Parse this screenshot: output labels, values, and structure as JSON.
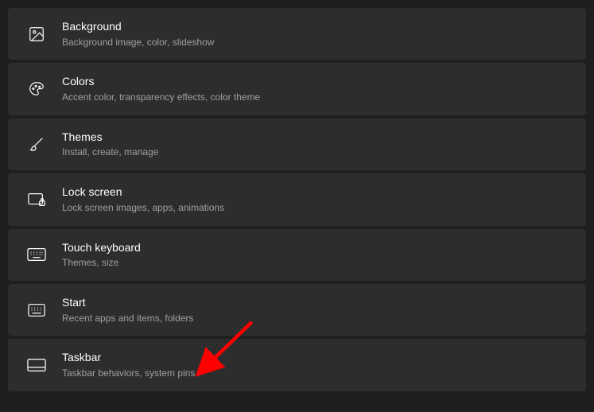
{
  "items": [
    {
      "title": "Background",
      "subtitle": "Background image, color, slideshow"
    },
    {
      "title": "Colors",
      "subtitle": "Accent color, transparency effects, color theme"
    },
    {
      "title": "Themes",
      "subtitle": "Install, create, manage"
    },
    {
      "title": "Lock screen",
      "subtitle": "Lock screen images, apps, animations"
    },
    {
      "title": "Touch keyboard",
      "subtitle": "Themes, size"
    },
    {
      "title": "Start",
      "subtitle": "Recent apps and items, folders"
    },
    {
      "title": "Taskbar",
      "subtitle": "Taskbar behaviors, system pins"
    }
  ]
}
